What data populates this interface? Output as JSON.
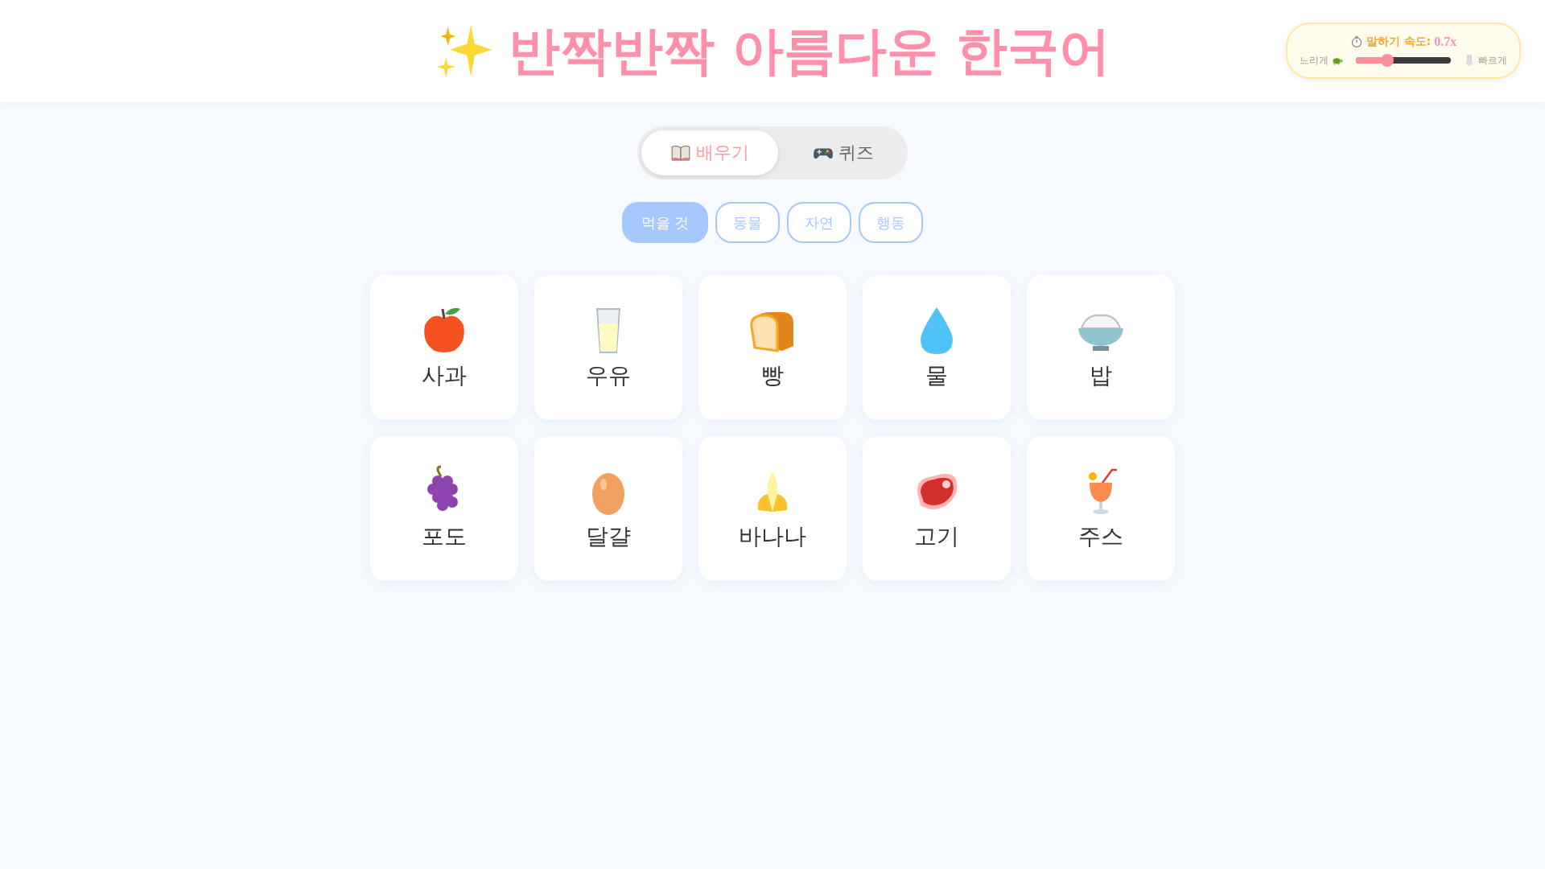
{
  "title": "반짝반짝 아름다운 한국어",
  "speed": {
    "label": "말하기 속도:",
    "reading": "0.7x",
    "slow_label": "느리게",
    "fast_label": "빠르게",
    "level": 0.33
  },
  "modes": [
    {
      "label": "배우기",
      "selected": true
    },
    {
      "label": "퀴즈",
      "selected": false
    }
  ],
  "categories": [
    {
      "label": "먹을 것",
      "selected": true
    },
    {
      "label": "동물",
      "selected": false
    },
    {
      "label": "자연",
      "selected": false
    },
    {
      "label": "행동",
      "selected": false
    }
  ],
  "words": [
    {
      "label": "사과"
    },
    {
      "label": "우유"
    },
    {
      "label": "빵"
    },
    {
      "label": "물"
    },
    {
      "label": "밥"
    },
    {
      "label": "포도"
    },
    {
      "label": "달걀"
    },
    {
      "label": "바나나"
    },
    {
      "label": "고기"
    },
    {
      "label": "주스"
    }
  ]
}
